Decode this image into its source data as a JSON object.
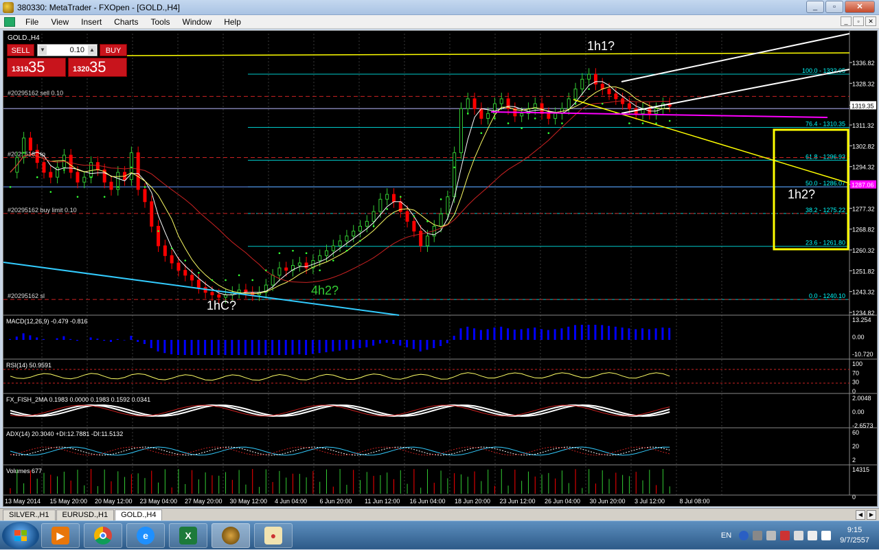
{
  "window": {
    "title": "380330: MetaTrader - FXOpen - [GOLD.,H4]",
    "minimize": "_",
    "restore": "▫",
    "close": "✕"
  },
  "menu": [
    "File",
    "View",
    "Insert",
    "Charts",
    "Tools",
    "Window",
    "Help"
  ],
  "chart_header": "GOLD.,H4",
  "one_click": {
    "sell_label": "SELL",
    "buy_label": "BUY",
    "lot": "0.10",
    "sell_small": "1319",
    "sell_big": "35",
    "buy_small": "1320",
    "buy_big": "35"
  },
  "price_axis": [
    "1336.82",
    "1328.32",
    "1319.35",
    "1311.32",
    "1302.82",
    "1294.32",
    "1287.06",
    "1277.32",
    "1268.82",
    "1260.32",
    "1251.82",
    "1243.32",
    "1234.82"
  ],
  "current_price": "1319.35",
  "marker_price": "1287.06",
  "fib_levels": [
    {
      "label": "100.0 - 1332.05",
      "price": 1332.05
    },
    {
      "label": "76.4 - 1310.35",
      "price": 1310.35
    },
    {
      "label": "61.8 - 1296.93",
      "price": 1296.93
    },
    {
      "label": "50.0 - 1286.07",
      "price": 1286.07
    },
    {
      "label": "38.2 - 1275.22",
      "price": 1275.22
    },
    {
      "label": "23.6 - 1261.80",
      "price": 1261.8
    },
    {
      "label": "0.0 - 1240.10",
      "price": 1240.1
    }
  ],
  "order_labels": [
    {
      "label": "#20295162 sell 0.10",
      "price": 1323
    },
    {
      "label": "#20295162 tp",
      "price": 1298
    },
    {
      "label": "#20295162 buy limit 0.10",
      "price": 1275.22
    },
    {
      "label": "#20295162 sl",
      "price": 1240.1
    }
  ],
  "annotations": [
    {
      "text": "1h1?",
      "color": "#ffffff"
    },
    {
      "text": "1hC?",
      "color": "#ffffff"
    },
    {
      "text": "4h2?",
      "color": "#33cc33"
    },
    {
      "text": "1h2?",
      "color": "#ffffff"
    }
  ],
  "subwindows": [
    {
      "label": "MACD(12,26,9) -0.479 -0.816",
      "scale": [
        "13.254",
        "0.00",
        "-10.720"
      ]
    },
    {
      "label": "RSI(14) 50.9591",
      "scale": [
        "100",
        "70",
        "30",
        "0"
      ]
    },
    {
      "label": "FX_FISH_2MA 0.1983 0.0000 0.1983 0.1592 0.0341",
      "scale": [
        "2.0048",
        "0.00",
        "-2.6573"
      ]
    },
    {
      "label": "ADX(14) 20.3040 +DI:12.7881 -DI:11.5132",
      "scale": [
        "60",
        "20",
        "2"
      ]
    },
    {
      "label": "Volumes 677",
      "scale": [
        "14315",
        "0"
      ]
    }
  ],
  "time_axis": [
    "13 May 2014",
    "15 May 20:00",
    "20 May 12:00",
    "23 May 04:00",
    "27 May 20:00",
    "30 May 12:00",
    "4 Jun 04:00",
    "6 Jun 20:00",
    "11 Jun 12:00",
    "16 Jun 04:00",
    "18 Jun 20:00",
    "23 Jun 12:00",
    "26 Jun 04:00",
    "30 Jun 20:00",
    "3 Jul 12:00",
    "8 Jul 08:00"
  ],
  "tabs": [
    "SILVER.,H1",
    "EURUSD.,H1",
    "GOLD.,H4"
  ],
  "active_tab": "GOLD.,H4",
  "taskbar": {
    "apps": [
      "windows-media-player",
      "chrome",
      "internet-explorer",
      "excel",
      "metatrader",
      "paint"
    ],
    "lang": "EN",
    "time": "9:15",
    "date": "9/7/2557"
  },
  "colors": {
    "bull": "#33cc33",
    "bear": "#ff0000",
    "fib": "#00ffff",
    "trend_yellow": "#ffff00",
    "trend_white": "#ffffff",
    "trend_cyan": "#33ccff",
    "box": "#ffff00",
    "macd": "#0000ff",
    "sar": "#33ff33"
  }
}
